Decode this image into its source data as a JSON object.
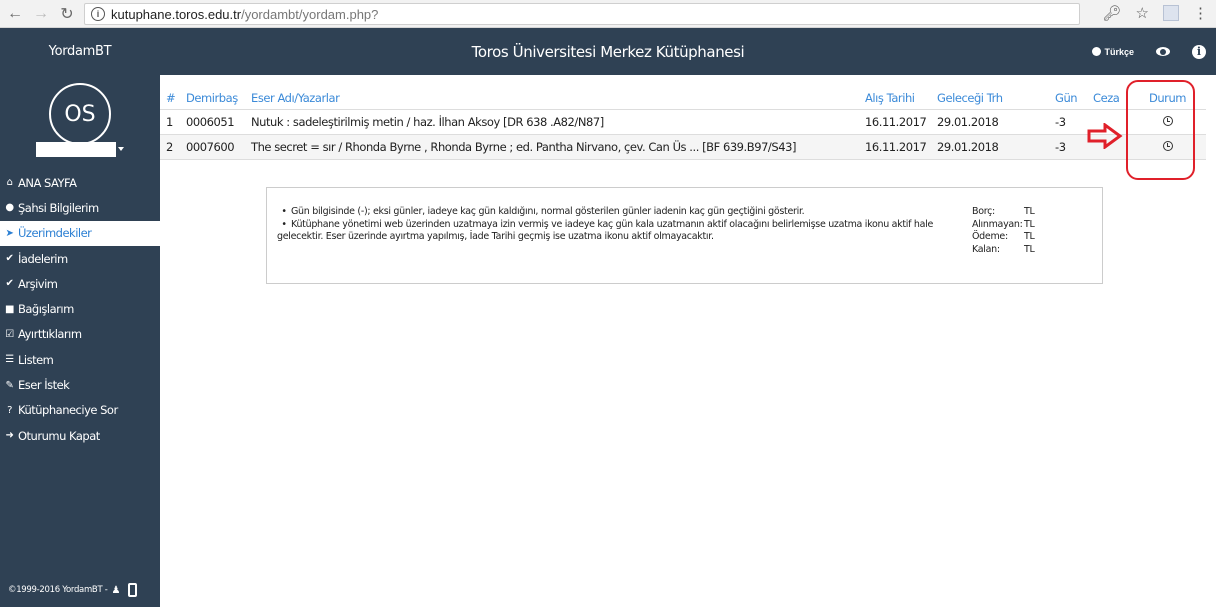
{
  "browser": {
    "url_host": "kutuphane.toros.edu.tr",
    "url_path": "/yordambt/yordam.php?"
  },
  "header": {
    "brand": "YordamBT",
    "title": "Toros Üniversitesi Merkez Kütüphanesi",
    "language": "Türkçe"
  },
  "sidebar": {
    "avatar_initials": "OS",
    "items": [
      {
        "label": "ANA SAYFA",
        "icon": "home-icon"
      },
      {
        "label": "Şahsi Bilgilerim",
        "icon": "user-icon"
      },
      {
        "label": "Üzerimdekiler",
        "icon": "arrow-circle-icon"
      },
      {
        "label": "İadelerim",
        "icon": "check-circle-icon"
      },
      {
        "label": "Arşivim",
        "icon": "check-circle-icon"
      },
      {
        "label": "Bağışlarım",
        "icon": "gift-icon"
      },
      {
        "label": "Ayırttıklarım",
        "icon": "calendar-check-icon"
      },
      {
        "label": "Listem",
        "icon": "list-icon"
      },
      {
        "label": "Eser İstek",
        "icon": "edit-icon"
      },
      {
        "label": "Kütüphaneciye Sor",
        "icon": "question-circle-icon"
      },
      {
        "label": "Oturumu Kapat",
        "icon": "sign-out-icon"
      }
    ],
    "active_index": 2,
    "footer": "©1999-2016 YordamBT - "
  },
  "table": {
    "headers": {
      "idx": "#",
      "demirbas": "Demirbaş",
      "eser": "Eser Adı/Yazarlar",
      "alis": "Alış Tarihi",
      "gelecegi": "Geleceği Trh",
      "gun": "Gün",
      "ceza": "Ceza",
      "durum": "Durum"
    },
    "rows": [
      {
        "idx": "1",
        "demirbas": "0006051",
        "eser": "Nutuk : sadeleştirilmiş metin / haz. İlhan Aksoy [DR 638 .A82/N87]",
        "alis": "16.11.2017",
        "gelecegi": "29.01.2018",
        "gun": "-3",
        "ceza": ""
      },
      {
        "idx": "2",
        "demirbas": "0007600",
        "eser": "The secret = sır / Rhonda Byrne , Rhonda Byrne ; ed. Pantha Nirvano, çev. Can Üs ... [BF 639.B97/S43]",
        "alis": "16.11.2017",
        "gelecegi": "29.01.2018",
        "gun": "-3",
        "ceza": ""
      }
    ]
  },
  "info": {
    "note1": "Gün bilgisinde (-); eksi günler, iadeye kaç gün kaldığını, normal gösterilen günler iadenin kaç gün geçtiğini gösterir.",
    "note2": "Kütüphane yönetimi web üzerinden uzatmaya izin vermiş ve iadeye kaç gün kala uzatmanın aktif olacağını belirlemişse uzatma ikonu aktif hale gelecektir. Eser üzerinde ayırtma yapılmış, İade Tarihi geçmiş ise uzatma ikonu aktif olmayacaktır.",
    "totals": [
      {
        "label": "Borç:",
        "value": "TL"
      },
      {
        "label": "Alınmayan:",
        "value": "TL"
      },
      {
        "label": "Ödeme:",
        "value": "TL"
      },
      {
        "label": "Kalan:",
        "value": "TL"
      }
    ]
  },
  "colors": {
    "navy": "#2f4154",
    "link_blue": "#3b8ad8",
    "annotation_red": "#e0202a"
  }
}
